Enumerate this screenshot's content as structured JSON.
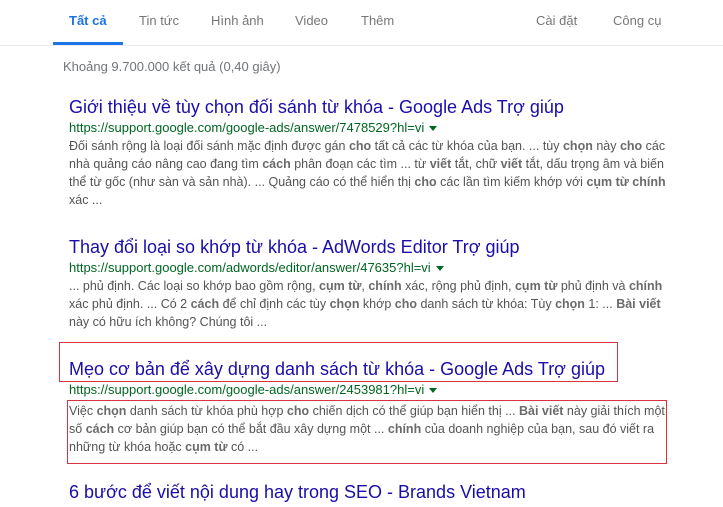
{
  "tabs": {
    "all": "Tất cả",
    "news": "Tin tức",
    "images": "Hình ảnh",
    "videos": "Video",
    "more": "Thêm",
    "settings": "Cài đặt",
    "tools": "Công cụ"
  },
  "stats": "Khoảng 9.700.000 kết quả (0,40 giây)",
  "results": [
    {
      "title": "Giới thiệu về tùy chọn đối sánh từ khóa - Google Ads Trợ giúp",
      "url": "https://support.google.com/google-ads/answer/7478529?hl=vi",
      "snippet": [
        "Đối sánh rộng là loại đối sánh mặc định được gán ",
        {
          "b": "cho"
        },
        " tất cả các từ khóa của bạn. ... tùy ",
        {
          "b": "chọn"
        },
        " này ",
        {
          "b": "cho"
        },
        " các nhà quảng cáo nâng cao đang tìm ",
        {
          "b": "cách"
        },
        " phân đoạn các tìm ... từ ",
        {
          "b": "viết"
        },
        " tắt, chữ ",
        {
          "b": "viết"
        },
        " tắt, dấu trọng âm và biến thể từ gốc (như sàn và sản nhà). ... Quảng cáo có thể hiển thị ",
        {
          "b": "cho"
        },
        " các lần tìm kiếm khớp với ",
        {
          "b": "cụm từ chính"
        },
        " xác ..."
      ]
    },
    {
      "title": "Thay đổi loại so khớp từ khóa - AdWords Editor Trợ giúp",
      "url": "https://support.google.com/adwords/editor/answer/47635?hl=vi",
      "snippet": [
        "... phủ định. Các loại so khớp bao gồm rộng, ",
        {
          "b": "cụm từ"
        },
        ", ",
        {
          "b": "chính"
        },
        " xác, rộng phủ định, ",
        {
          "b": "cụm từ"
        },
        " phủ định và ",
        {
          "b": "chính"
        },
        " xác phủ định. ... Có 2 ",
        {
          "b": "cách"
        },
        " để chỉ định các tùy ",
        {
          "b": "chọn"
        },
        " khớp ",
        {
          "b": "cho"
        },
        " danh sách từ khóa: Tùy ",
        {
          "b": "chọn"
        },
        " 1: ... ",
        {
          "b": "Bài viết"
        },
        " này có hữu ích không? Chúng tôi ..."
      ]
    },
    {
      "title": "Mẹo cơ bản để xây dựng danh sách từ khóa - Google Ads Trợ giúp",
      "url": "https://support.google.com/google-ads/answer/2453981?hl=vi",
      "snippet": [
        "Việc ",
        {
          "b": "chọn"
        },
        " danh sách từ khóa phù hợp ",
        {
          "b": "cho"
        },
        " chiến dịch có thể giúp bạn hiển thị ... ",
        {
          "b": "Bài viết"
        },
        " này giải thích một số ",
        {
          "b": "cách"
        },
        " cơ bản giúp bạn có thể bắt đầu xây dựng một ... ",
        {
          "b": "chính"
        },
        " của doanh nghiệp của bạn, sau đó viết ra những từ khóa hoặc ",
        {
          "b": "cụm từ"
        },
        " có ..."
      ]
    },
    {
      "title": "6 bước để viết nội dung hay trong SEO - Brands Vietnam"
    }
  ],
  "colors": {
    "accent": "#1a73e8",
    "title": "#1a0dab",
    "url": "#006621",
    "highlight": "#d9333f"
  }
}
